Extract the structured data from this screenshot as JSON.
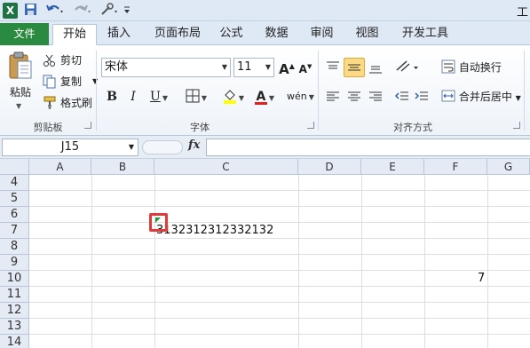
{
  "title_fragment": "工",
  "tabs": [
    "文件",
    "开始",
    "插入",
    "页面布局",
    "公式",
    "数据",
    "审阅",
    "视图",
    "开发工具"
  ],
  "clipboard": {
    "paste_label": "粘贴",
    "cut_label": "剪切",
    "copy_label": "复制",
    "format_painter_label": "格式刷",
    "group_label": "剪贴板"
  },
  "font": {
    "name": "宋体",
    "size": "11",
    "bold": "B",
    "italic": "I",
    "underline": "U",
    "group_label": "字体",
    "grow_label": "A",
    "shrink_label": "A",
    "color_label": "A",
    "phonetic_label": "wén"
  },
  "alignment": {
    "wrap_label": "自动换行",
    "merge_label": "合并后居中",
    "group_label": "对齐方式"
  },
  "formula_bar": {
    "name_box": "J15",
    "fx_label": "fx",
    "formula": ""
  },
  "sheet": {
    "columns": [
      "A",
      "B",
      "C",
      "D",
      "E",
      "F",
      "G"
    ],
    "rows": [
      "4",
      "5",
      "6",
      "7",
      "8",
      "9",
      "10",
      "11",
      "12",
      "13",
      "14"
    ],
    "cells": [
      {
        "row": "7",
        "col": "C",
        "value": "3132312312332132"
      },
      {
        "row": "10",
        "col": "F",
        "value": "7"
      }
    ]
  },
  "colors": {
    "file_tab": "#2a8a3f",
    "highlight_box": "#e03a3a",
    "error_indicator": "#1a9a3a"
  }
}
